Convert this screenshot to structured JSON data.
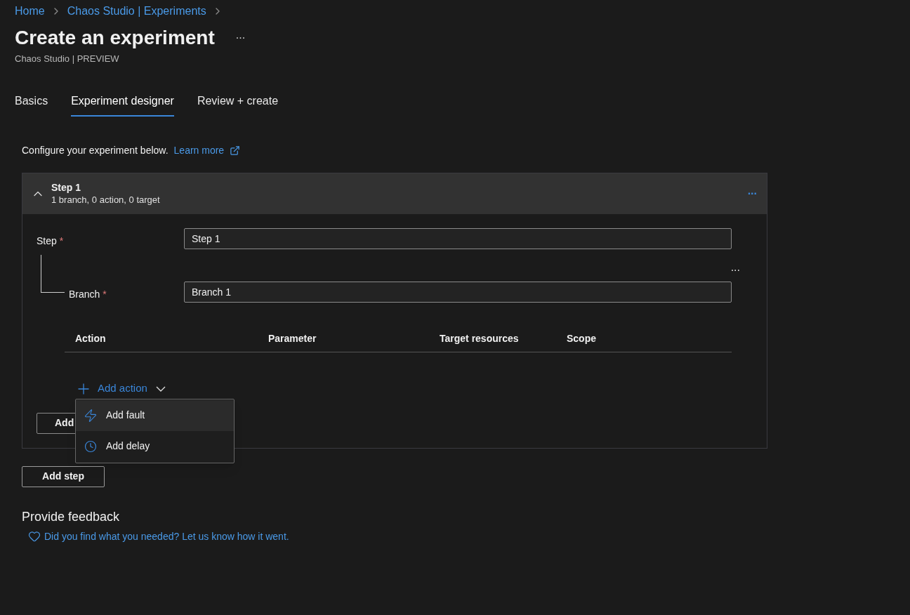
{
  "breadcrumb": [
    "Home",
    "Chaos Studio | Experiments"
  ],
  "title": "Create an experiment",
  "more": "...",
  "subtitle": "Chaos Studio | PREVIEW",
  "tabs": [
    {
      "label": "Basics",
      "selected": false
    },
    {
      "label": "Experiment designer",
      "selected": true
    },
    {
      "label": "Review + create",
      "selected": false
    }
  ],
  "intro": {
    "text": "Configure your experiment below.",
    "link": "Learn more"
  },
  "step_card": {
    "expanded": true,
    "title": "Step 1",
    "summary": "1 branch, 0 action, 0 target",
    "more": "...",
    "step_field": {
      "label": "Step",
      "required_mark": "*",
      "value": "Step 1"
    },
    "branch_more": "...",
    "branch_field": {
      "label": "Branch",
      "required_mark": "*",
      "value": "Branch 1"
    },
    "table": {
      "columns": [
        "Action",
        "Parameter",
        "Target resources",
        "Scope"
      ]
    },
    "add_action": "Add action",
    "add_branch_button": "Add"
  },
  "action_menu": [
    {
      "kind": "fault",
      "label": "Add fault",
      "highlighted": true
    },
    {
      "kind": "delay",
      "label": "Add delay",
      "highlighted": false
    }
  ],
  "add_step_button": "Add step",
  "feedback": {
    "heading": "Provide feedback",
    "link": "Did you find what you needed? Let us know how it went."
  }
}
